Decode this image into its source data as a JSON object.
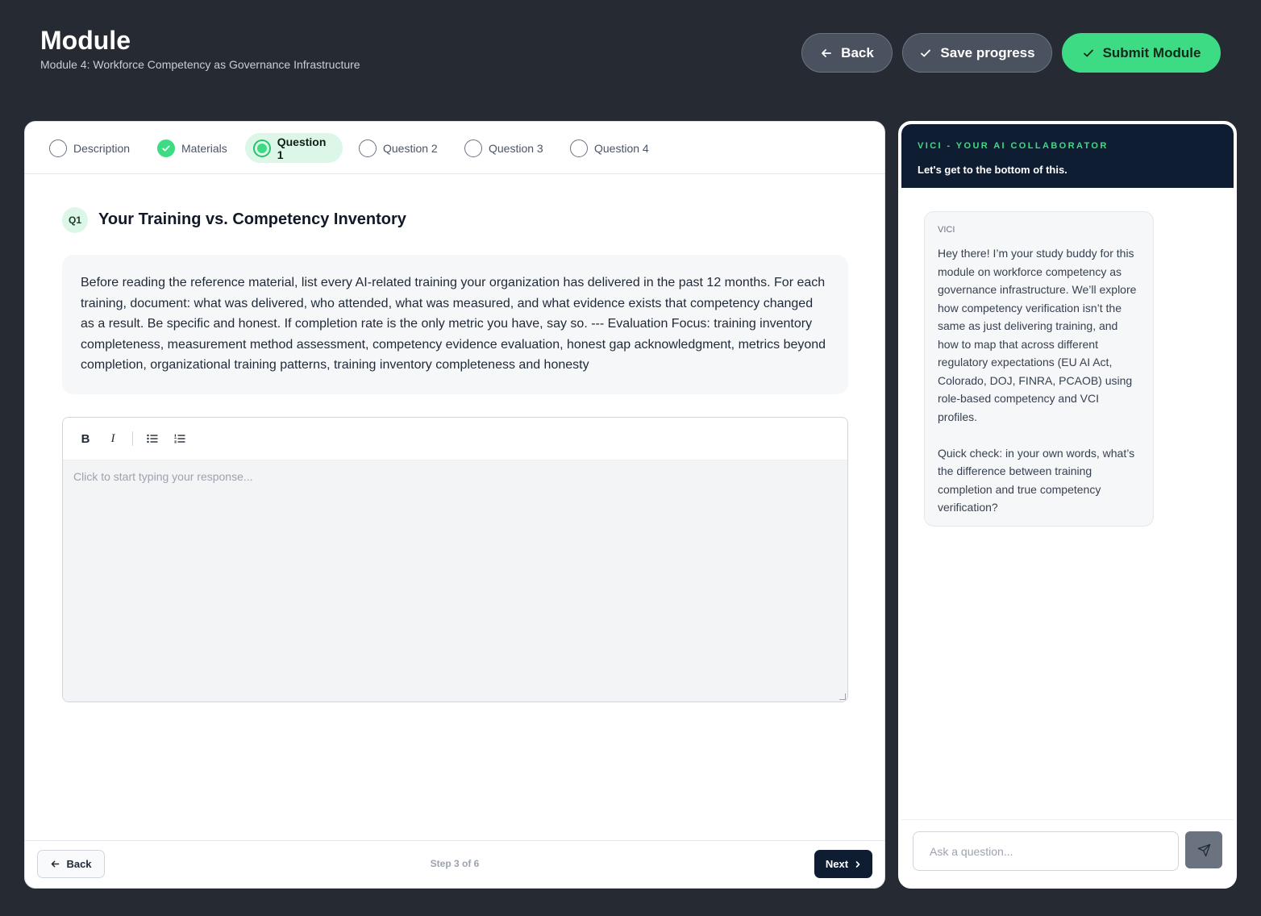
{
  "header": {
    "title": "Module",
    "subtitle": "Module 4: Workforce Competency as Governance Infrastructure",
    "back_label": "Back",
    "save_label": "Save progress",
    "submit_label": "Submit Module"
  },
  "tabs": [
    {
      "label": "Description",
      "state": "pending"
    },
    {
      "label": "Materials",
      "state": "done"
    },
    {
      "label": "Question 1",
      "state": "active"
    },
    {
      "label": "Question 2",
      "state": "pending"
    },
    {
      "label": "Question 3",
      "state": "pending"
    },
    {
      "label": "Question 4",
      "state": "pending"
    }
  ],
  "question": {
    "badge": "Q1",
    "title": "Your Training vs. Competency Inventory",
    "prompt": "Before reading the reference material, list every AI-related training your organization has delivered in the past 12 months. For each training, document: what was delivered, who attended, what was measured, and what evidence exists that competency changed as a result. Be specific and honest. If completion rate is the only metric you have, say so. --- Evaluation Focus: training inventory completeness, measurement method assessment, competency evidence evaluation, honest gap acknowledgment, metrics beyond completion, organizational training patterns, training inventory completeness and honesty"
  },
  "editor": {
    "bold_label": "B",
    "italic_label": "I",
    "placeholder": "Click to start typing your response...",
    "value": ""
  },
  "footer": {
    "back_label": "Back",
    "step_text": "Step 3 of 6",
    "next_label": "Next"
  },
  "assistant": {
    "kicker": "VICI - YOUR AI COLLABORATOR",
    "tagline": "Let's get to the bottom of this.",
    "sender": "VICI",
    "message": "Hey there! I’m your study buddy for this module on workforce competency as governance infrastructure. We’ll explore how competency verification isn’t the same as just delivering training, and how to map that across different regulatory expectations (EU AI Act, Colorado, DOJ, FINRA, PCAOB) using role-based competency and VCI profiles.\n\nQuick check: in your own words, what’s the difference between training completion and true competency verification?",
    "input_placeholder": "Ask a question...",
    "input_value": ""
  },
  "colors": {
    "background": "#252a33",
    "accent_green": "#3ddc84",
    "navy": "#0f1d33",
    "active_tab_bg": "#dcf7e8"
  },
  "icons": [
    "arrow-left-icon",
    "check-icon",
    "bold-icon",
    "italic-icon",
    "bullet-list-icon",
    "numbered-list-icon",
    "chevron-right-icon",
    "send-icon"
  ]
}
